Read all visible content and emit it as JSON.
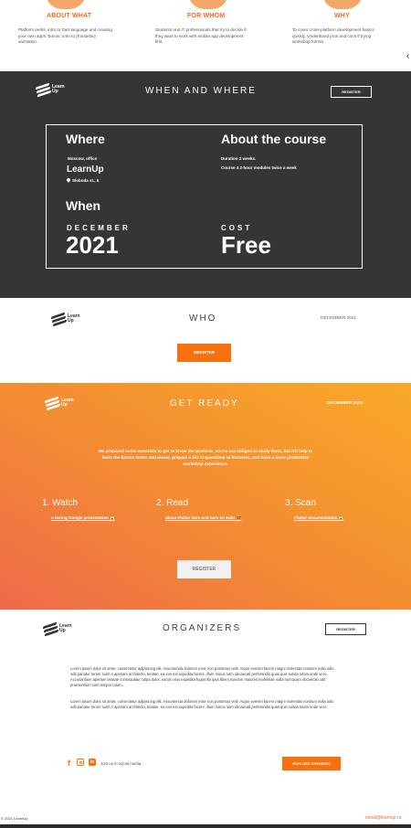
{
  "intro_columns": [
    {
      "title": "ABOUT WHAT",
      "text": "Platform perks, intro to Dart language and creating your own apps. Bonus: intro to [Fantastic] animation."
    },
    {
      "title": "FOR WHOM",
      "text": "Students and IT professionals that try to decide if they want to work with mobile app development first."
    },
    {
      "title": "WHY",
      "text": "To cover cross-platform development basics quickly. Understand pros and cons if trying workshop format."
    }
  ],
  "logo": {
    "word": "Learn Up"
  },
  "when_where": {
    "title": "WHEN AND WHERE",
    "register_label": "REGISTER",
    "where_heading": "Where",
    "where_city": "Moscow, office",
    "where_brand": "LearnUp",
    "where_address": "Sloboda st., 5",
    "about_heading": "About the course",
    "about_duration": "Duration 2 weeks.",
    "about_modules": "Course 4 2-hour modules twice a week",
    "when_heading": "When",
    "when_month": "DECEMBER",
    "when_year": "2021",
    "cost_label": "COST",
    "cost_value": "Free"
  },
  "who": {
    "title": "WHO",
    "date": "DECEMBER 2021",
    "register_label": "REGISTER"
  },
  "get_ready": {
    "title": "GET READY",
    "date": "DECEMBER 2021",
    "intro": "We prepared some materials to get to know the platform. You're not obliged to study them, but it'll help to learn the basics faster and easier, prepare a list of questions to lecturers, and have a more productive workshop experience.",
    "steps": [
      {
        "heading": "1. Watch",
        "link": "a boring Google presentation 😱"
      },
      {
        "heading": "2. Read",
        "link": "about Flutter here and here on Habr 🤓"
      },
      {
        "heading": "3. Scan",
        "link": "Flutter documentation 😱"
      }
    ],
    "register_label": "REGISTER"
  },
  "organizers": {
    "title": "ORGANIZERS",
    "register_label": "REGISTER",
    "paragraphs": [
      "Lorem ipsum dolor sit amet, consectetur adipisicing elit. Assumenda dolorem esse non possimus velit. Atque eveniet facere magni molestias nostrum nulla odio odit pariatur rerum sunt! A aperiam architecto, beatae, ea eos est expedita facere, illum minus nam obcaecati perferendis quas quis soluta totam unde vero. Accusantium aperiam beatae consequatur culpa dolor, earum eius expedita fugiat illo ipsa libero maxime maiores molestiae nulla numquam obcaecati odit praesentium sunt tempor totam.",
      "Lorem ipsum dolor sit amet, consectetur adipisicing elit. Assumenda dolorem esse non possimus velit. Atque eveniet facere magni molestias nostrum nulla odio odit pariatur rerum sunt! A aperiam architecto, beatae, ea eos est expedita facere, illum minus nam obcaecati perferendis quas quis soluta totam unde vero."
    ],
    "social": {
      "facebook": "f",
      "linkedin": "in"
    },
    "join_text": "Join us in social media",
    "explore_label": "EXPLORE OPENINGS"
  },
  "footer": {
    "copyright": "© 2021 LearnUp",
    "email": "email@learnup.ru"
  },
  "colors": {
    "accent": "#f7720f",
    "dark": "#353535"
  }
}
